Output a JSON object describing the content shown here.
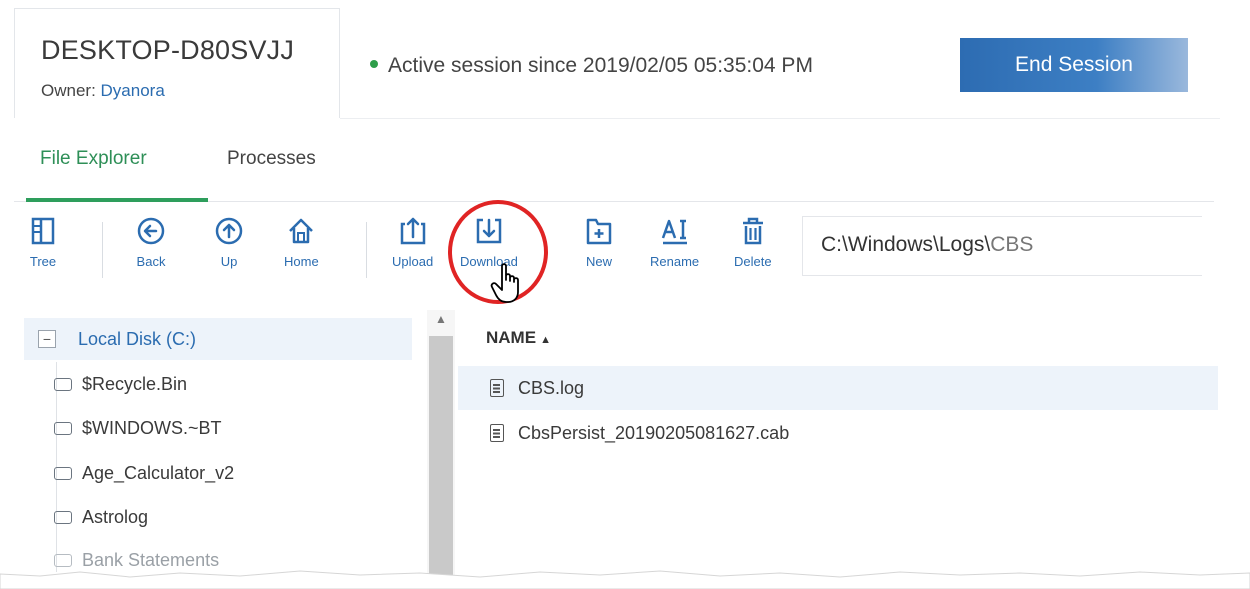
{
  "device": {
    "name": "DESKTOP-D80SVJJ",
    "owner_label": "Owner:",
    "owner_name": "Dyanora"
  },
  "session": {
    "status_text": "Active session since 2019/02/05 05:35:04 PM",
    "end_button": "End Session"
  },
  "tabs": [
    {
      "label": "File Explorer",
      "active": true
    },
    {
      "label": "Processes",
      "active": false
    }
  ],
  "toolbar": {
    "tree": "Tree",
    "back": "Back",
    "up": "Up",
    "home": "Home",
    "upload": "Upload",
    "download": "Download",
    "new": "New",
    "rename": "Rename",
    "delete": "Delete"
  },
  "path": {
    "head": "C:\\Windows\\Logs\\",
    "tail": "CBS"
  },
  "tree": {
    "root": "Local Disk (C:)",
    "items": [
      "$Recycle.Bin",
      "$WINDOWS.~BT",
      "Age_Calculator_v2",
      "Astrolog",
      "Bank Statements"
    ]
  },
  "files": {
    "column_name": "NAME",
    "rows": [
      "CBS.log",
      "CbsPersist_20190205081627.cab"
    ]
  },
  "colors": {
    "accent_blue": "#2b6cb0",
    "accent_green": "#2e8f57",
    "highlight_red": "#e02424"
  }
}
